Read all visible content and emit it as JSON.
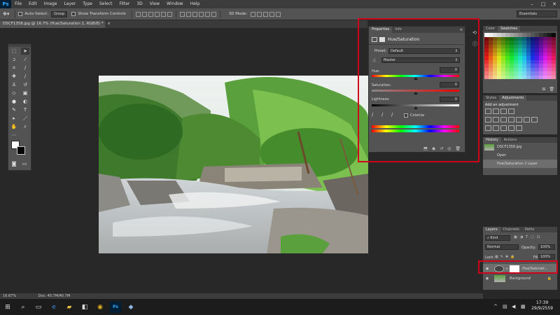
{
  "app": {
    "logo": "Ps"
  },
  "menu": [
    "File",
    "Edit",
    "Image",
    "Layer",
    "Type",
    "Select",
    "Filter",
    "3D",
    "View",
    "Window",
    "Help"
  ],
  "window_controls": [
    "–",
    "□",
    "✕"
  ],
  "options": {
    "auto_select_label": "Auto-Select:",
    "auto_select_value": "Group",
    "show_transform_label": "Show Transform Controls",
    "mode_3d_label": "3D Mode:",
    "workspace": "Essentials"
  },
  "document": {
    "tab_title": "DSCF1358.jpg @ 16.7% (Hue/Saturation 1, RGB/8) *",
    "close": "×"
  },
  "properties": {
    "tabs": [
      "Properties",
      "Info"
    ],
    "panel_title": "Hue/Saturation",
    "preset_label": "Preset:",
    "preset_value": "Default",
    "channel_value": "Master",
    "hue_label": "Hue:",
    "hue_value": "0",
    "saturation_label": "Saturation:",
    "saturation_value": "0",
    "lightness_label": "Lightness:",
    "lightness_value": "0",
    "colorize_label": "Colorize"
  },
  "swatches": {
    "tabs": [
      "Color",
      "Swatches"
    ]
  },
  "adjustments": {
    "tabs": [
      "Styles",
      "Adjustments"
    ],
    "heading": "Add an adjustment"
  },
  "history": {
    "tabs": [
      "History",
      "Actions"
    ],
    "snapshot": "DSCF1358.jpg",
    "items": [
      "Open",
      "Hue/Saturation 1 Layer"
    ]
  },
  "layers": {
    "tabs": [
      "Layers",
      "Channels",
      "Paths"
    ],
    "kind_label": "Kind",
    "blend_mode": "Normal",
    "opacity_label": "Opacity:",
    "opacity_value": "100%",
    "lock_label": "Lock:",
    "fill_label": "Fill:",
    "fill_value": "100%",
    "layer1_name": "Hue/Saturati...",
    "layer2_name": "Background"
  },
  "status": {
    "zoom": "16.67%",
    "doc": "Doc: 40.7M/40.7M"
  },
  "clock": {
    "time": "17:39",
    "date": "29/9/2559"
  },
  "colors": {
    "highlight_box": "#d0021b",
    "panel_bg": "#535353",
    "workspace_bg": "#282828"
  }
}
